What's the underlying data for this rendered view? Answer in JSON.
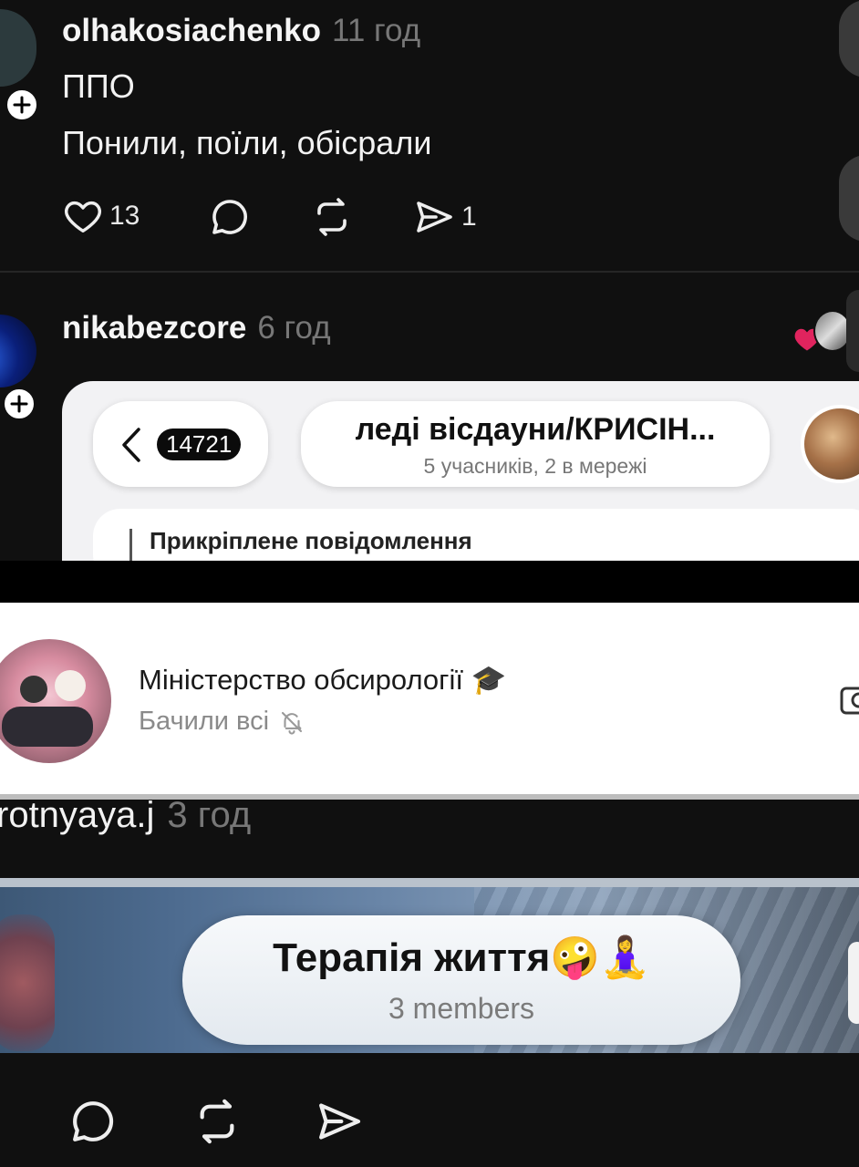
{
  "post1": {
    "username": "olhakosiachenko",
    "time": "11 год",
    "line1": "ППО",
    "line2": "Понили, поїли, обісрали",
    "likes": "13",
    "shares": "1"
  },
  "post2": {
    "username": "nikabezcore",
    "time": "6 год",
    "screenshot": {
      "back_count": "14721",
      "chat_title": "леді вісдауни/КРИСІН...",
      "chat_subtitle": "5 учасників, 2 в мережі",
      "pinned_label": "Прикріплене повідомлення"
    }
  },
  "panel3": {
    "channel_title": "Міністерство обсирології 🎓",
    "channel_subtitle": "Бачили всі"
  },
  "post4": {
    "username": "rotnyaya.j",
    "time": "3 год",
    "group_title": "Терапія життя🤪🧘‍♀️",
    "group_subtitle": "3 members"
  },
  "colors": {
    "background": "#101010",
    "like_heart": "#e0245e"
  },
  "icons": [
    "heart-icon",
    "comment-icon",
    "repost-icon",
    "share-icon",
    "plus-icon",
    "back-chevron-icon",
    "mute-bell-icon",
    "camera-icon"
  ]
}
